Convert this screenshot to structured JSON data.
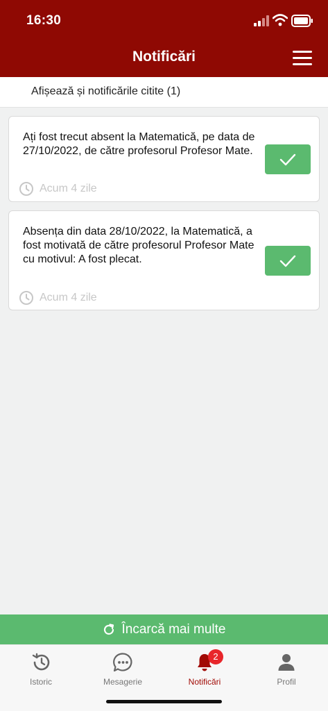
{
  "status_bar": {
    "time": "16:30"
  },
  "header": {
    "title": "Notificări"
  },
  "filter": {
    "label": "Afișează și notificările citite (1)"
  },
  "notifications": [
    {
      "message": "Ați fost trecut absent la Matematică, pe data de 27/10/2022, de către profesorul Profesor Mate.",
      "time": "Acum 4 zile"
    },
    {
      "message": "Absența din data 28/10/2022, la Matematică, a fost motivată de către profesorul Profesor Mate cu motivul: A fost plecat.",
      "time": "Acum 4 zile"
    }
  ],
  "load_more": {
    "label": "Încarcă mai multe"
  },
  "tabs": [
    {
      "label": "Istoric",
      "icon": "history-icon"
    },
    {
      "label": "Mesagerie",
      "icon": "chat-icon"
    },
    {
      "label": "Notificări",
      "icon": "bell-icon",
      "badge": "2",
      "active": true
    },
    {
      "label": "Profil",
      "icon": "user-icon"
    }
  ],
  "colors": {
    "primary": "#8f0903",
    "success": "#5bba6f",
    "badge": "#e8262b",
    "background": "#f0f1f1"
  }
}
